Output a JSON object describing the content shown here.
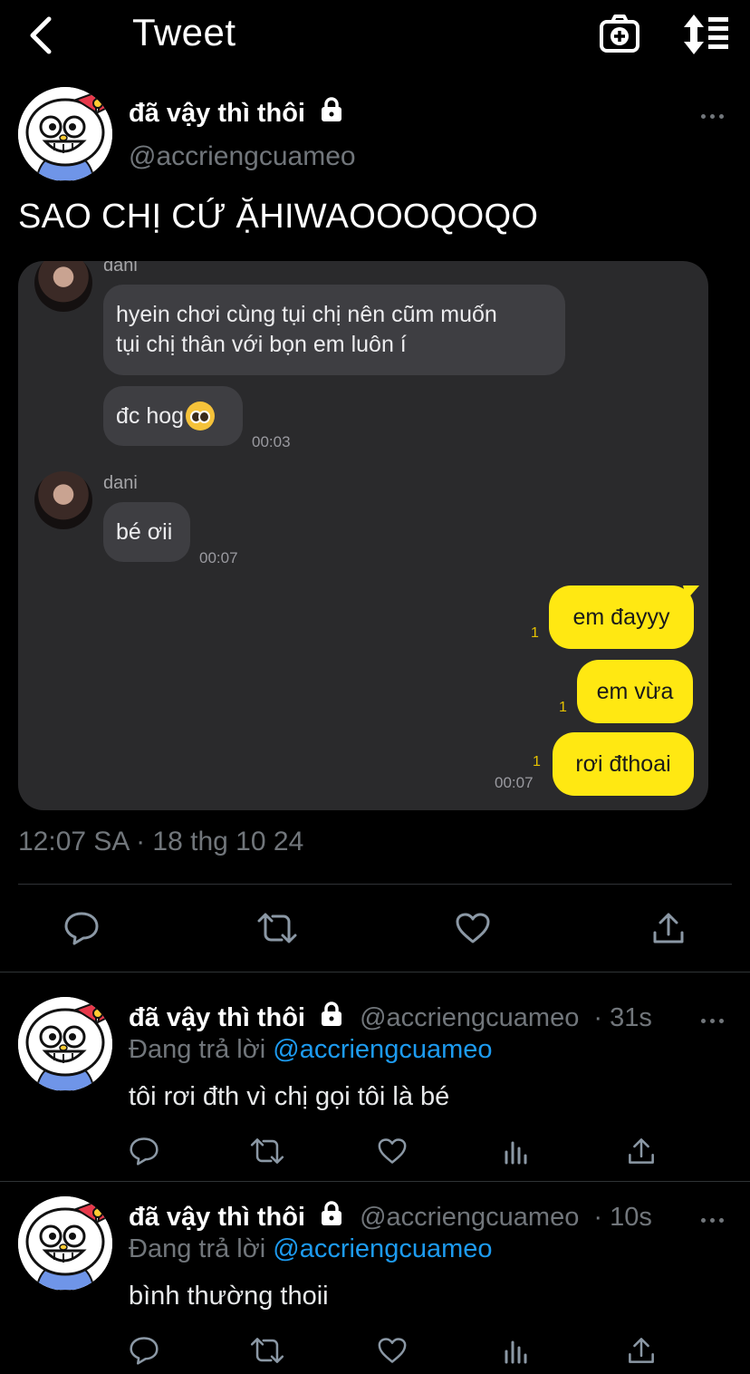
{
  "header": {
    "title": "Tweet"
  },
  "main_tweet": {
    "display_name": "đã vậy thì thôi",
    "handle": "@accriengcuameo",
    "text": "SAO CHỊ CỨ ẶHIWAOOOQOQO",
    "timestamp": "12:07 SA · 18 thg 10 24"
  },
  "chat": {
    "messages_in_1": {
      "sender": "dani",
      "line1": "hyein chơi cùng tụi chị nên cũm muốn",
      "line2": "tụi chị thân với bọn em luôn í",
      "msg2": "đc hog",
      "time": "00:03"
    },
    "messages_in_2": {
      "sender": "dani",
      "msg": "bé ơii",
      "time": "00:07"
    },
    "messages_out": [
      {
        "text": "em đayyy",
        "unread": "1"
      },
      {
        "text": "em vừa",
        "unread": "1"
      },
      {
        "text": "rơi đthoai",
        "unread": "1"
      }
    ],
    "out_time": "00:07"
  },
  "replies": [
    {
      "display_name": "đã vậy thì thôi",
      "handle": "@accriengcuameo",
      "age": "· 31s",
      "replying_label": "Đang trả lời",
      "mention": "@accriengcuameo",
      "text": "tôi rơi đth vì chị gọi tôi là bé"
    },
    {
      "display_name": "đã vậy thì thôi",
      "handle": "@accriengcuameo",
      "age": "· 10s",
      "replying_label": "Đang trả lời",
      "mention": "@accriengcuameo",
      "text": "bình thường thoii"
    }
  ],
  "icons": {
    "back": "chevron-left-icon",
    "camera": "camera-plus-icon",
    "sort": "sort-icon",
    "reply": "reply-icon",
    "retweet": "retweet-icon",
    "like": "heart-icon",
    "views": "analytics-icon",
    "share": "share-icon"
  },
  "colors": {
    "accent": "#1d9bf0",
    "muted": "#71767b",
    "kakao_yellow": "#ffe812"
  }
}
